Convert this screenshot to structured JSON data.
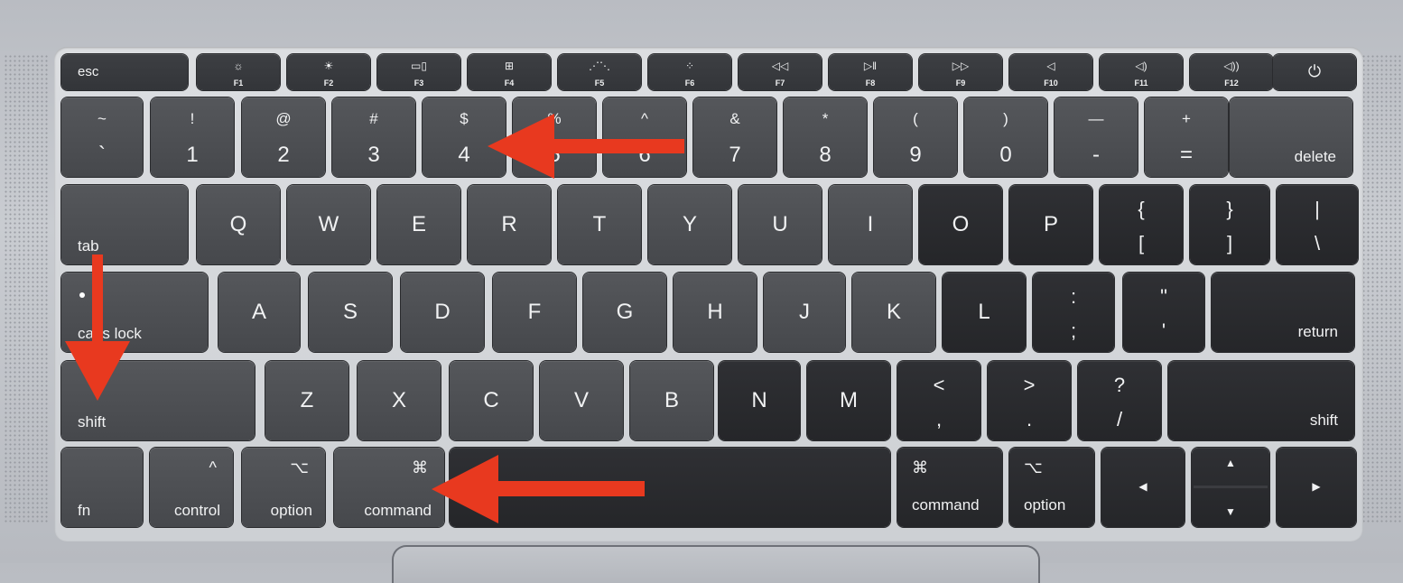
{
  "annotation": {
    "arrow_color": "#e8391f",
    "arrows": [
      {
        "name": "arrow-pointing-to-4-key",
        "direction": "left",
        "target": "4"
      },
      {
        "name": "arrow-from-tab-to-shift",
        "direction": "down",
        "target": "shift"
      },
      {
        "name": "arrow-pointing-to-command-key",
        "direction": "left",
        "target": "command"
      }
    ]
  },
  "keyboard": {
    "function_row": [
      {
        "label": "esc"
      },
      {
        "label": "F1",
        "icon": "☼"
      },
      {
        "label": "F2",
        "icon": "☀"
      },
      {
        "label": "F3",
        "icon": "▭▯"
      },
      {
        "label": "F4",
        "icon": "⊞"
      },
      {
        "label": "F5",
        "icon": "⋰⋱"
      },
      {
        "label": "F6",
        "icon": "⁘"
      },
      {
        "label": "F7",
        "icon": "◁◁"
      },
      {
        "label": "F8",
        "icon": "▷‖"
      },
      {
        "label": "F9",
        "icon": "▷▷"
      },
      {
        "label": "F10",
        "icon": "◁"
      },
      {
        "label": "F11",
        "icon": "◁)"
      },
      {
        "label": "F12",
        "icon": "◁))"
      },
      {
        "label": "",
        "icon": "⏻"
      }
    ],
    "number_row": [
      {
        "upper": "~",
        "lower": "`"
      },
      {
        "upper": "!",
        "lower": "1"
      },
      {
        "upper": "@",
        "lower": "2"
      },
      {
        "upper": "#",
        "lower": "3"
      },
      {
        "upper": "$",
        "lower": "4"
      },
      {
        "upper": "%",
        "lower": "5"
      },
      {
        "upper": "^",
        "lower": "6"
      },
      {
        "upper": "&",
        "lower": "7"
      },
      {
        "upper": "*",
        "lower": "8"
      },
      {
        "upper": "(",
        "lower": "9"
      },
      {
        "upper": ")",
        "lower": "0"
      },
      {
        "upper": "—",
        "lower": "-"
      },
      {
        "upper": "+",
        "lower": "="
      },
      {
        "label": "delete"
      }
    ],
    "qwerty_row": [
      {
        "label": "tab"
      },
      {
        "letter": "Q"
      },
      {
        "letter": "W"
      },
      {
        "letter": "E"
      },
      {
        "letter": "R"
      },
      {
        "letter": "T"
      },
      {
        "letter": "Y"
      },
      {
        "letter": "U"
      },
      {
        "letter": "I"
      },
      {
        "letter": "O"
      },
      {
        "letter": "P"
      },
      {
        "upper": "{",
        "lower": "["
      },
      {
        "upper": "}",
        "lower": "]"
      },
      {
        "upper": "|",
        "lower": "\\"
      }
    ],
    "home_row": [
      {
        "label": "caps lock"
      },
      {
        "letter": "A"
      },
      {
        "letter": "S"
      },
      {
        "letter": "D"
      },
      {
        "letter": "F"
      },
      {
        "letter": "G"
      },
      {
        "letter": "H"
      },
      {
        "letter": "J"
      },
      {
        "letter": "K"
      },
      {
        "letter": "L"
      },
      {
        "upper": ":",
        "lower": ";"
      },
      {
        "upper": "\"",
        "lower": "'"
      },
      {
        "label": "return"
      }
    ],
    "shift_row": [
      {
        "label": "shift"
      },
      {
        "letter": "Z"
      },
      {
        "letter": "X"
      },
      {
        "letter": "C"
      },
      {
        "letter": "V"
      },
      {
        "letter": "B"
      },
      {
        "letter": "N"
      },
      {
        "letter": "M"
      },
      {
        "upper": "<",
        "lower": ","
      },
      {
        "upper": ">",
        "lower": "."
      },
      {
        "upper": "?",
        "lower": "/"
      },
      {
        "label": "shift"
      }
    ],
    "bottom_row": [
      {
        "label": "fn"
      },
      {
        "label": "control",
        "symbol": "^"
      },
      {
        "label": "option",
        "symbol": "⌥"
      },
      {
        "label": "command",
        "symbol": "⌘"
      },
      {
        "label": ""
      },
      {
        "label": "command",
        "symbol": "⌘"
      },
      {
        "label": "option",
        "symbol": "⌥"
      },
      {
        "label": "",
        "glyph": "◀"
      },
      {
        "label": "",
        "glyph_up": "▲",
        "glyph_down": "▼"
      },
      {
        "label": "",
        "glyph": "▶"
      }
    ]
  }
}
